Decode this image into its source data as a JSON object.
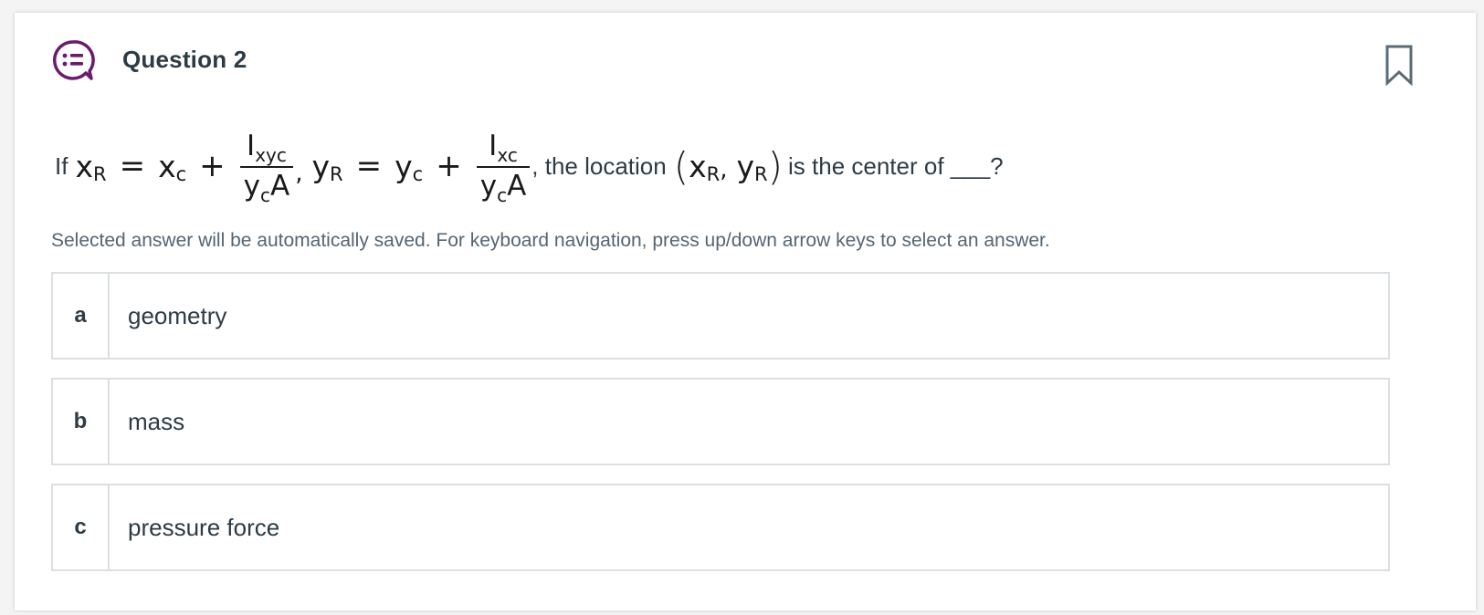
{
  "question": {
    "title": "Question 2",
    "prefix": "If",
    "xr_var": "x",
    "xr_sub": "R",
    "xc_var": "x",
    "xc_sub": "c",
    "frac1_num_var": "I",
    "frac1_num_sub": "xyc",
    "frac1_den_var": "y",
    "frac1_den_sub": "c",
    "frac1_den_tail": "A",
    "yr_var": "y",
    "yr_sub": "R",
    "yc_var": "y",
    "yc_sub": "c",
    "frac2_num_var": "I",
    "frac2_num_sub": "xc",
    "frac2_den_var": "y",
    "frac2_den_sub": "c",
    "frac2_den_tail": "A",
    "equals": "=",
    "plus": "+",
    "comma": ",",
    "middle_text": ", the location",
    "open_paren": "(",
    "close_paren": ")",
    "suffix": "is the center of ___?"
  },
  "instructions": "Selected answer will be automatically saved. For keyboard navigation, press up/down arrow keys to select an answer.",
  "answers": [
    {
      "letter": "a",
      "label": "geometry"
    },
    {
      "letter": "b",
      "label": "mass"
    },
    {
      "letter": "c",
      "label": "pressure force"
    }
  ],
  "icons": {
    "question": "question-list-icon",
    "bookmark": "bookmark-icon"
  },
  "colors": {
    "accent": "#6b1a6e",
    "text": "#2d3b45",
    "border": "#dcdfe2"
  }
}
